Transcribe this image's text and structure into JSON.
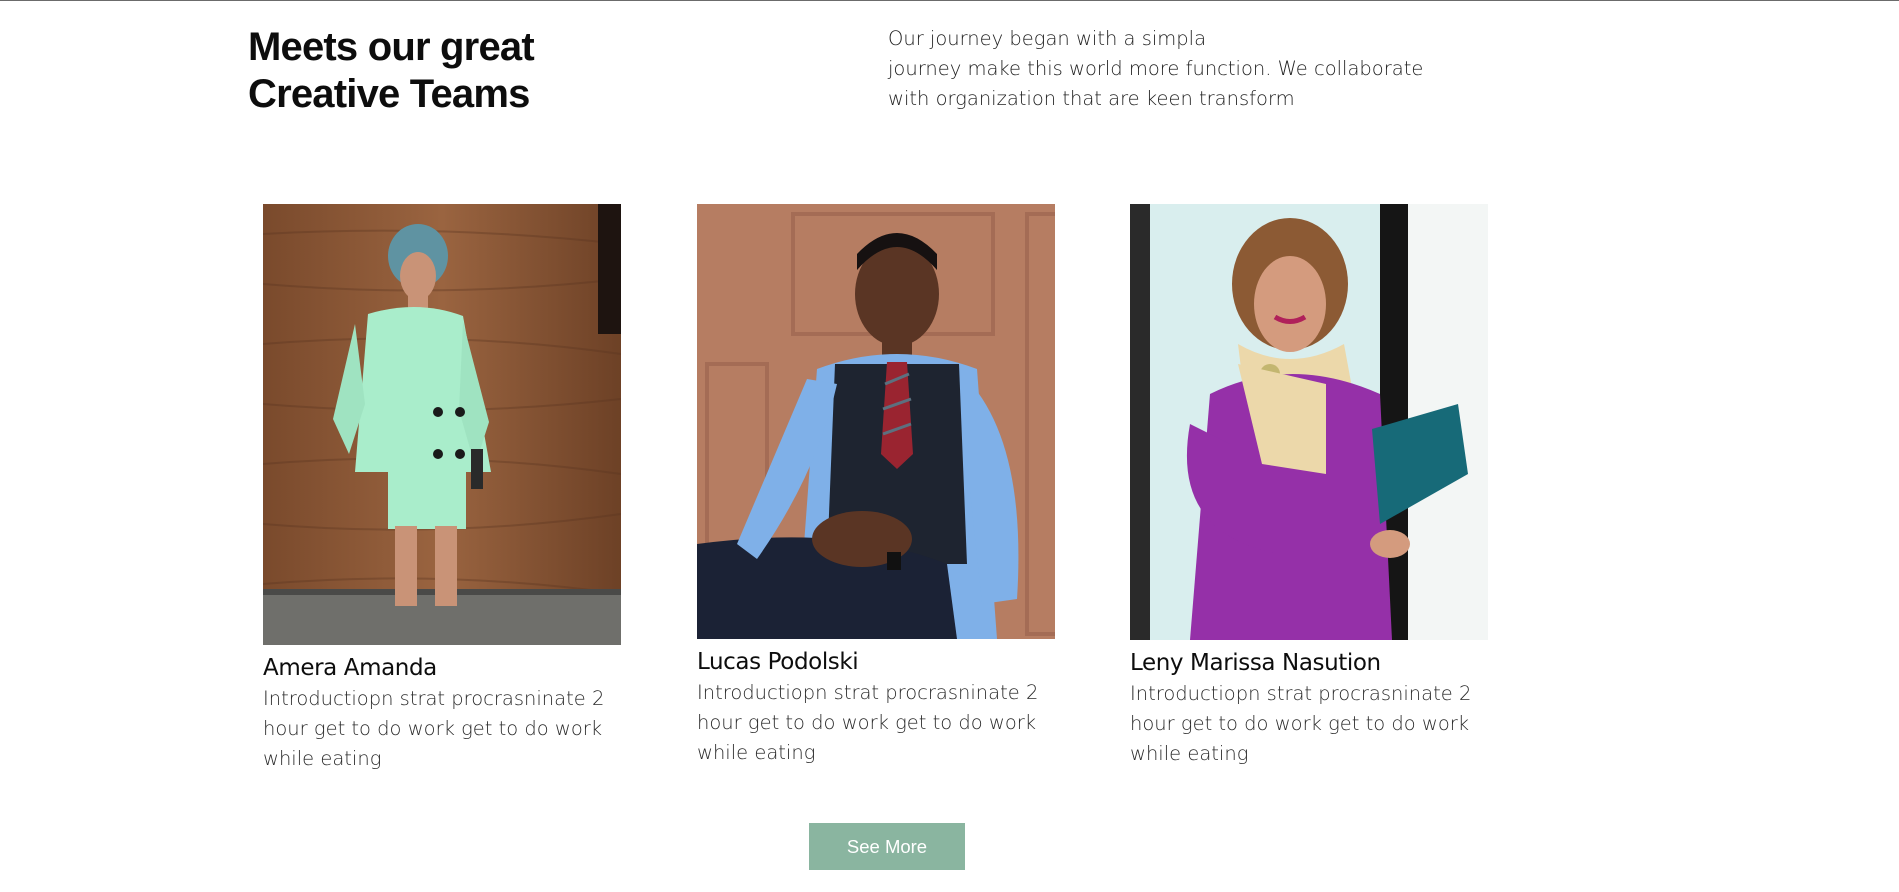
{
  "section": {
    "heading_line1": "Meets our great",
    "heading_line2": "Creative Teams",
    "intro_line1": "Our journey began with a simpla",
    "intro_line2": "journey make this world more function. We collaborate",
    "intro_line3": "with organization that are keen transform"
  },
  "team": [
    {
      "name": "Amera Amanda",
      "bio_line1": "Introductiopn strat procrasninate 2",
      "bio_line2": "hour get to do work get to do work",
      "bio_line3": "while eating",
      "photo_alt": "woman in mint green suit and teal headwrap"
    },
    {
      "name": "Lucas Podolski",
      "bio_line1": "Introductiopn strat procrasninate 2",
      "bio_line2": "hour get to do work get to do work",
      "bio_line3": "while eating",
      "photo_alt": "man in black vest, blue shirt and red striped tie"
    },
    {
      "name": "Leny Marissa Nasution",
      "bio_line1": "Introductiopn strat procrasninate 2",
      "bio_line2": "hour get to do work get to do work",
      "bio_line3": "while eating",
      "photo_alt": "woman in purple dress with scarf holding a folder"
    }
  ],
  "actions": {
    "see_more_label": "See More"
  },
  "colors": {
    "accent_button": "#8ab5a0",
    "heading_text": "#0d0d0d",
    "body_text": "#222222"
  }
}
